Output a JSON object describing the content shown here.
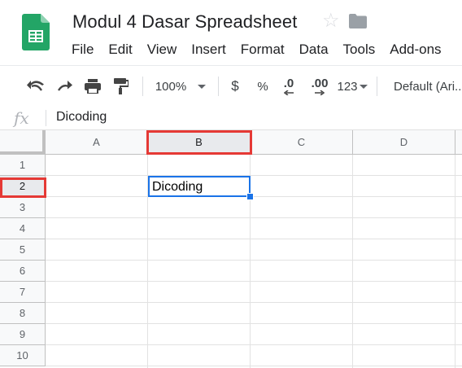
{
  "document": {
    "title": "Modul 4 Dasar Spreadsheet"
  },
  "menu": [
    "File",
    "Edit",
    "View",
    "Insert",
    "Format",
    "Data",
    "Tools",
    "Add-ons"
  ],
  "toolbar": {
    "zoom": "100%",
    "currency": "$",
    "percent": "%",
    "decrease_decimal": ".0",
    "increase_decimal": ".00",
    "more_formats": "123",
    "font": "Default (Ari..."
  },
  "formula_bar": {
    "fx": "fx",
    "value": "Dicoding"
  },
  "grid": {
    "columns": [
      "A",
      "B",
      "C",
      "D"
    ],
    "rows": [
      "1",
      "2",
      "3",
      "4",
      "5",
      "6",
      "7",
      "8",
      "9",
      "10"
    ],
    "selected_column": "B",
    "selected_row": "2",
    "cells": {
      "B2": "Dicoding"
    }
  },
  "colors": {
    "sheets_green": "#23a566",
    "selection_blue": "#1a73e8",
    "highlight_red": "#e53935"
  }
}
